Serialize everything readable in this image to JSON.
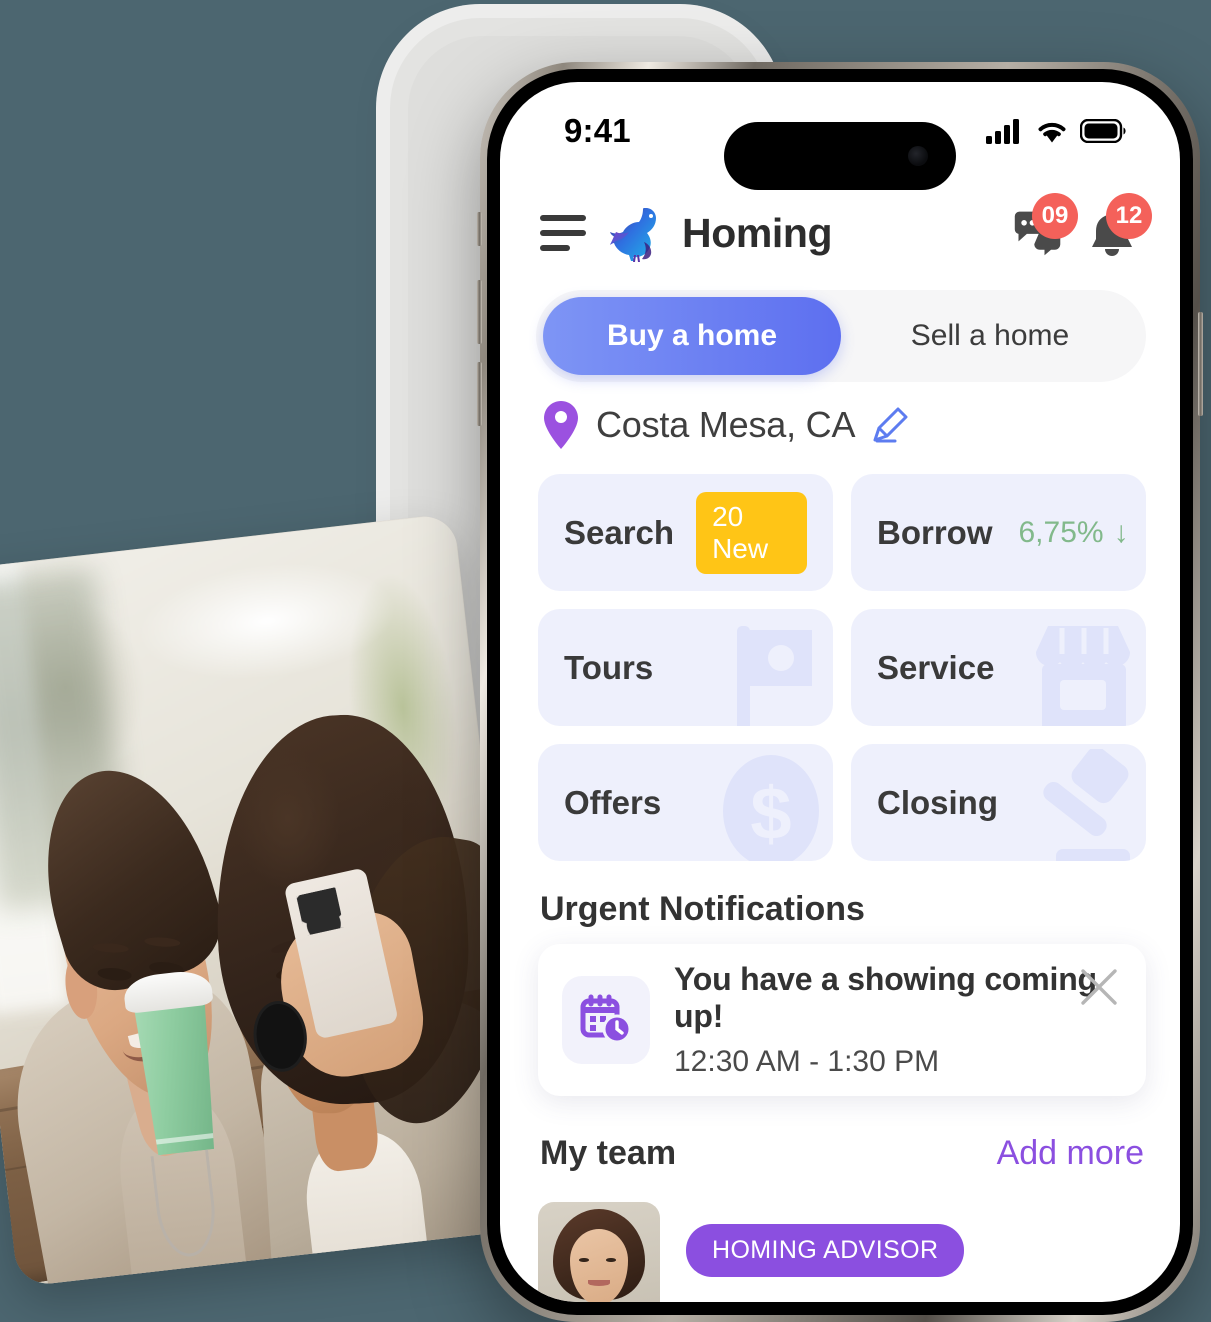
{
  "background": {
    "color": "#4c6670"
  },
  "photo_card": {
    "alt": "Smiling couple looking at a phone at a cafe table with a green coffee cup",
    "name": "lifestyle-photo"
  },
  "phone": {
    "status_bar": {
      "time": "9:41",
      "icons": [
        "cellular-signal-icon",
        "wifi-icon",
        "battery-icon"
      ]
    },
    "header": {
      "menu_icon": "hamburger-menu-icon",
      "logo_icon": "homing-bird-logo",
      "brand": "Homing",
      "messages": {
        "icon": "chat-bubble-icon",
        "badge": "09"
      },
      "notifications": {
        "icon": "bell-icon",
        "badge": "12"
      }
    },
    "segmented": {
      "options": [
        {
          "label": "Buy a home",
          "active": true
        },
        {
          "label": "Sell a home",
          "active": false
        }
      ]
    },
    "location": {
      "pin_icon": "map-pin-icon",
      "text": "Costa Mesa, CA",
      "edit_icon": "pencil-edit-icon"
    },
    "tiles": [
      {
        "label": "Search",
        "badge": "20 New",
        "art": "magnifier-art",
        "badge_color": "#ffc516"
      },
      {
        "label": "Borrow",
        "rate": "6,75%",
        "trend": "↓",
        "art": "percent-art",
        "rate_color": "#82b98b"
      },
      {
        "label": "Tours",
        "art": "flag-icon"
      },
      {
        "label": "Service",
        "art": "storefront-icon"
      },
      {
        "label": "Offers",
        "art": "dollar-coin-icon"
      },
      {
        "label": "Closing",
        "art": "gavel-icon"
      }
    ],
    "notifications_section": {
      "title": "Urgent Notifications",
      "items": [
        {
          "icon": "calendar-clock-icon",
          "title": "You have a showing coming up!",
          "subtitle": "12:30 AM - 1:30 PM",
          "close_icon": "close-icon"
        }
      ]
    },
    "team_section": {
      "title": "My team",
      "action": "Add more",
      "members": [
        {
          "avatar": "team-member-avatar",
          "role": "HOMING ADVISOR"
        }
      ]
    }
  },
  "colors": {
    "accent_blue": "#5d6ff0",
    "accent_purple": "#8b4fe0",
    "badge_red": "#f4615a",
    "badge_yellow": "#ffc516",
    "rate_green": "#82b98b",
    "tile_bg": "#eef0fc"
  }
}
